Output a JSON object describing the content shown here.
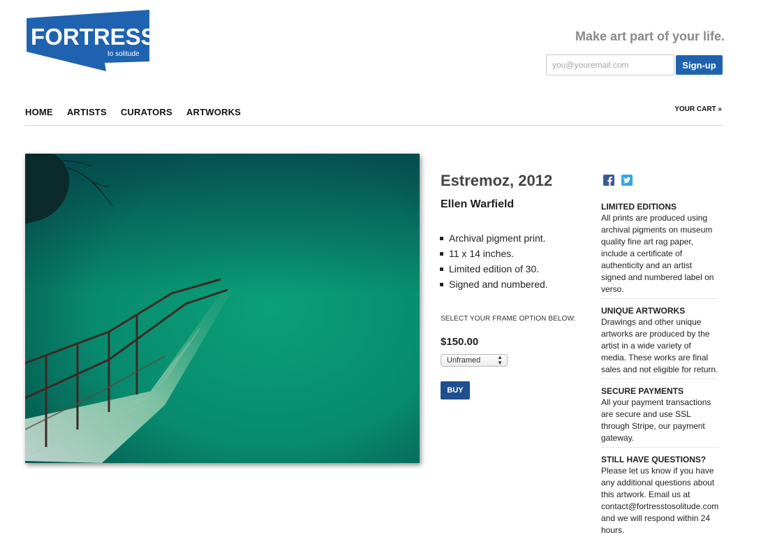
{
  "brand": {
    "name": "FORTRESS",
    "sub": "to solitude",
    "color": "#1f63b0"
  },
  "header": {
    "tagline": "Make art part of your life.",
    "email_placeholder": "you@youremail.com",
    "signup_label": "Sign-up"
  },
  "nav": {
    "items": [
      "HOME",
      "ARTISTS",
      "CURATORS",
      "ARTWORKS"
    ],
    "cart_label": "YOUR CART »"
  },
  "product": {
    "title": "Estremoz, 2012",
    "artist": "Ellen Warfield",
    "features": [
      "Archival pigment print.",
      "11 x 14 inches.",
      "Limited edition of 30.",
      "Signed and numbered."
    ],
    "frame_prompt": "SELECT YOUR FRAME OPTION BELOW:",
    "price": "$150.00",
    "frame_selected": "Unframed",
    "buy_label": "BUY"
  },
  "social": {
    "icons": [
      "facebook-icon",
      "twitter-icon"
    ]
  },
  "info": [
    {
      "heading": "LIMITED EDITIONS",
      "body": "All prints are produced using archival pigments on museum quality fine art rag paper, include a certificate of authenticity and an artist signed and numbered label on verso."
    },
    {
      "heading": "UNIQUE ARTWORKS",
      "body": "Drawings and other unique artworks are produced by the artist in a wide variety of media. These works are final sales and not eligible for return."
    },
    {
      "heading": "SECURE PAYMENTS",
      "body": "All your payment transactions are secure and use SSL through Stripe, our payment gateway."
    },
    {
      "heading": "STILL HAVE QUESTIONS?",
      "body": "Please let us know if you have any additional questions about this artwork. Email us at contact@fortresstosolitude.com and we will respond within 24 hours."
    }
  ]
}
